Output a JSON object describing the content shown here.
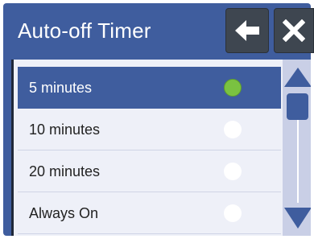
{
  "header": {
    "title": "Auto-off Timer",
    "back_icon": "arrow-left-icon",
    "close_icon": "close-icon"
  },
  "options": [
    {
      "label": "5 minutes",
      "selected": true
    },
    {
      "label": "10 minutes",
      "selected": false
    },
    {
      "label": "20 minutes",
      "selected": false
    },
    {
      "label": "Always On",
      "selected": false
    }
  ],
  "colors": {
    "accent": "#3f5d9e",
    "selected_radio": "#7ac241",
    "header_button": "#3e4650"
  }
}
